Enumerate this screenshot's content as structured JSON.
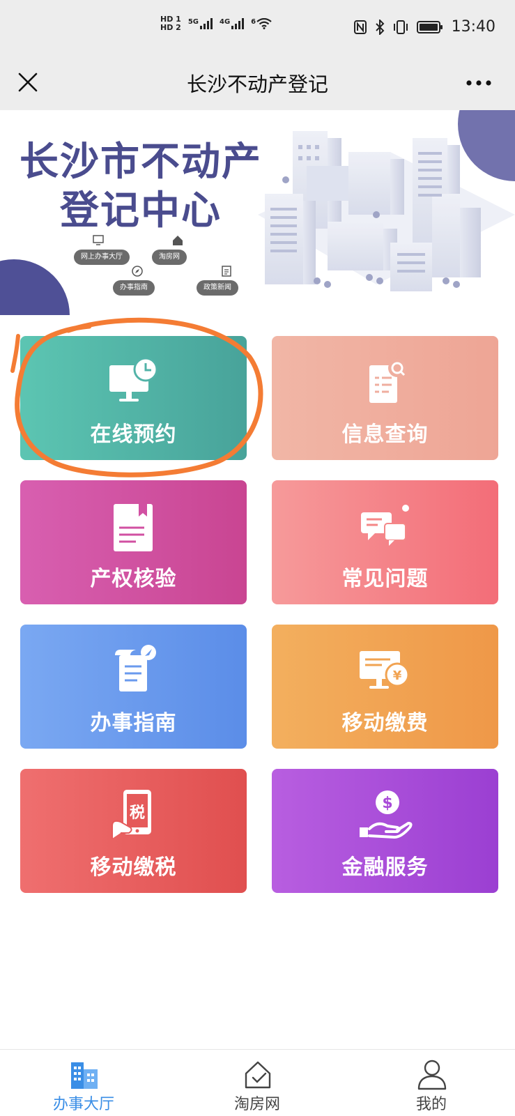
{
  "status_bar": {
    "network_left": "HD 1",
    "network_left2": "HD 2",
    "signal1": "5G",
    "signal2": "4G",
    "wifi": "6",
    "time": "13:40"
  },
  "title_bar": {
    "title": "长沙不动产登记",
    "close_icon": "close-icon",
    "more_icon": "more-icon"
  },
  "banner": {
    "title_line1": "长沙市不动产",
    "title_line2": "登记中心",
    "pills": [
      "网上办事大厅",
      "淘房网",
      "办事指南",
      "政策新闻"
    ]
  },
  "tiles": [
    {
      "label": "在线预约",
      "icon": "computer-clock-icon",
      "color_from": "#5cc5b2",
      "color_to": "#48a39a"
    },
    {
      "label": "信息查询",
      "icon": "document-search-icon",
      "color_from": "#f1b6a6",
      "color_to": "#eea595"
    },
    {
      "label": "产权核验",
      "icon": "document-bookmark-icon",
      "color_from": "#d85fb0",
      "color_to": "#c94592"
    },
    {
      "label": "常见问题",
      "icon": "chat-bubbles-icon",
      "color_from": "#f69a9a",
      "color_to": "#f36d78"
    },
    {
      "label": "办事指南",
      "icon": "guide-paper-icon",
      "color_from": "#7aa8f2",
      "color_to": "#5b8de8"
    },
    {
      "label": "移动缴费",
      "icon": "monitor-yen-icon",
      "color_from": "#f3af5e",
      "color_to": "#ef9848"
    },
    {
      "label": "移动缴税",
      "icon": "phone-tax-icon",
      "color_from": "#ef6f6f",
      "color_to": "#e04f4f"
    },
    {
      "label": "金融服务",
      "icon": "hand-dollar-icon",
      "color_from": "#b85ee0",
      "color_to": "#9b3fd2"
    }
  ],
  "tax_char": "税",
  "dollar_char": "$",
  "yen_char": "¥",
  "tab_bar": {
    "tabs": [
      {
        "label": "办事大厅",
        "icon": "building-icon",
        "active": true
      },
      {
        "label": "淘房网",
        "icon": "house-check-icon",
        "active": false
      },
      {
        "label": "我的",
        "icon": "user-icon",
        "active": false
      }
    ]
  },
  "colors": {
    "accent": "#3a8ee6",
    "annotation": "#f47c34",
    "banner_title": "#4a4c8e"
  }
}
